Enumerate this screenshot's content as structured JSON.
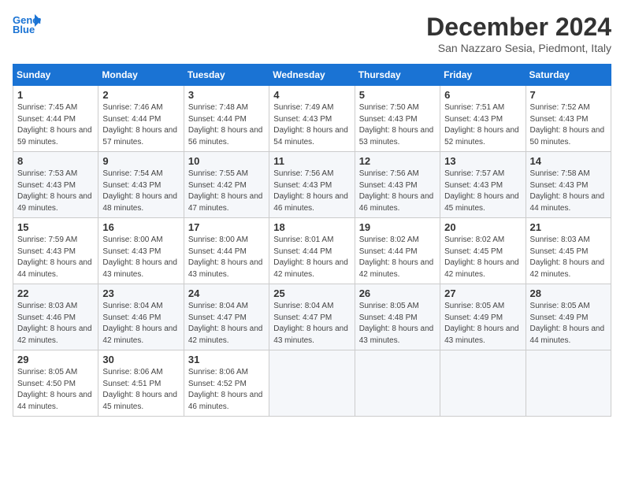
{
  "header": {
    "logo_line1": "General",
    "logo_line2": "Blue",
    "month": "December 2024",
    "location": "San Nazzaro Sesia, Piedmont, Italy"
  },
  "weekdays": [
    "Sunday",
    "Monday",
    "Tuesday",
    "Wednesday",
    "Thursday",
    "Friday",
    "Saturday"
  ],
  "weeks": [
    [
      {
        "day": "1",
        "sunrise": "7:45 AM",
        "sunset": "4:44 PM",
        "daylight": "8 hours and 59 minutes."
      },
      {
        "day": "2",
        "sunrise": "7:46 AM",
        "sunset": "4:44 PM",
        "daylight": "8 hours and 57 minutes."
      },
      {
        "day": "3",
        "sunrise": "7:48 AM",
        "sunset": "4:44 PM",
        "daylight": "8 hours and 56 minutes."
      },
      {
        "day": "4",
        "sunrise": "7:49 AM",
        "sunset": "4:43 PM",
        "daylight": "8 hours and 54 minutes."
      },
      {
        "day": "5",
        "sunrise": "7:50 AM",
        "sunset": "4:43 PM",
        "daylight": "8 hours and 53 minutes."
      },
      {
        "day": "6",
        "sunrise": "7:51 AM",
        "sunset": "4:43 PM",
        "daylight": "8 hours and 52 minutes."
      },
      {
        "day": "7",
        "sunrise": "7:52 AM",
        "sunset": "4:43 PM",
        "daylight": "8 hours and 50 minutes."
      }
    ],
    [
      {
        "day": "8",
        "sunrise": "7:53 AM",
        "sunset": "4:43 PM",
        "daylight": "8 hours and 49 minutes."
      },
      {
        "day": "9",
        "sunrise": "7:54 AM",
        "sunset": "4:43 PM",
        "daylight": "8 hours and 48 minutes."
      },
      {
        "day": "10",
        "sunrise": "7:55 AM",
        "sunset": "4:42 PM",
        "daylight": "8 hours and 47 minutes."
      },
      {
        "day": "11",
        "sunrise": "7:56 AM",
        "sunset": "4:43 PM",
        "daylight": "8 hours and 46 minutes."
      },
      {
        "day": "12",
        "sunrise": "7:56 AM",
        "sunset": "4:43 PM",
        "daylight": "8 hours and 46 minutes."
      },
      {
        "day": "13",
        "sunrise": "7:57 AM",
        "sunset": "4:43 PM",
        "daylight": "8 hours and 45 minutes."
      },
      {
        "day": "14",
        "sunrise": "7:58 AM",
        "sunset": "4:43 PM",
        "daylight": "8 hours and 44 minutes."
      }
    ],
    [
      {
        "day": "15",
        "sunrise": "7:59 AM",
        "sunset": "4:43 PM",
        "daylight": "8 hours and 44 minutes."
      },
      {
        "day": "16",
        "sunrise": "8:00 AM",
        "sunset": "4:43 PM",
        "daylight": "8 hours and 43 minutes."
      },
      {
        "day": "17",
        "sunrise": "8:00 AM",
        "sunset": "4:44 PM",
        "daylight": "8 hours and 43 minutes."
      },
      {
        "day": "18",
        "sunrise": "8:01 AM",
        "sunset": "4:44 PM",
        "daylight": "8 hours and 42 minutes."
      },
      {
        "day": "19",
        "sunrise": "8:02 AM",
        "sunset": "4:44 PM",
        "daylight": "8 hours and 42 minutes."
      },
      {
        "day": "20",
        "sunrise": "8:02 AM",
        "sunset": "4:45 PM",
        "daylight": "8 hours and 42 minutes."
      },
      {
        "day": "21",
        "sunrise": "8:03 AM",
        "sunset": "4:45 PM",
        "daylight": "8 hours and 42 minutes."
      }
    ],
    [
      {
        "day": "22",
        "sunrise": "8:03 AM",
        "sunset": "4:46 PM",
        "daylight": "8 hours and 42 minutes."
      },
      {
        "day": "23",
        "sunrise": "8:04 AM",
        "sunset": "4:46 PM",
        "daylight": "8 hours and 42 minutes."
      },
      {
        "day": "24",
        "sunrise": "8:04 AM",
        "sunset": "4:47 PM",
        "daylight": "8 hours and 42 minutes."
      },
      {
        "day": "25",
        "sunrise": "8:04 AM",
        "sunset": "4:47 PM",
        "daylight": "8 hours and 43 minutes."
      },
      {
        "day": "26",
        "sunrise": "8:05 AM",
        "sunset": "4:48 PM",
        "daylight": "8 hours and 43 minutes."
      },
      {
        "day": "27",
        "sunrise": "8:05 AM",
        "sunset": "4:49 PM",
        "daylight": "8 hours and 43 minutes."
      },
      {
        "day": "28",
        "sunrise": "8:05 AM",
        "sunset": "4:49 PM",
        "daylight": "8 hours and 44 minutes."
      }
    ],
    [
      {
        "day": "29",
        "sunrise": "8:05 AM",
        "sunset": "4:50 PM",
        "daylight": "8 hours and 44 minutes."
      },
      {
        "day": "30",
        "sunrise": "8:06 AM",
        "sunset": "4:51 PM",
        "daylight": "8 hours and 45 minutes."
      },
      {
        "day": "31",
        "sunrise": "8:06 AM",
        "sunset": "4:52 PM",
        "daylight": "8 hours and 46 minutes."
      },
      null,
      null,
      null,
      null
    ]
  ]
}
